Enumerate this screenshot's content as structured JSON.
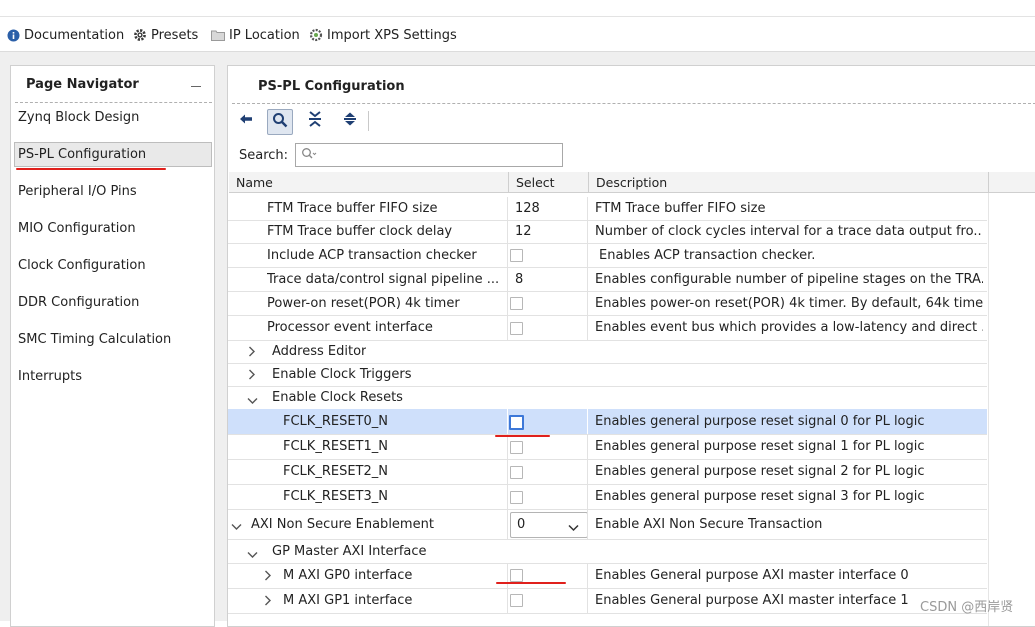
{
  "toolbar": {
    "documentation": "Documentation",
    "presets": "Presets",
    "ip_location": "IP Location",
    "import_xps": "Import XPS Settings"
  },
  "navigator": {
    "title": "Page Navigator",
    "items": [
      {
        "label": "Zynq Block Design"
      },
      {
        "label": "PS-PL Configuration"
      },
      {
        "label": "Peripheral I/O Pins"
      },
      {
        "label": "MIO Configuration"
      },
      {
        "label": "Clock Configuration"
      },
      {
        "label": "DDR Configuration"
      },
      {
        "label": "SMC Timing Calculation"
      },
      {
        "label": "Interrupts"
      }
    ],
    "selected_index": 1
  },
  "main": {
    "title": "PS-PL Configuration",
    "search_label": "Search:",
    "search_placeholder": "",
    "columns": {
      "name": "Name",
      "select": "Select",
      "description": "Description"
    },
    "rows": {
      "r0": {
        "name": "FTM Trace buffer FIFO size",
        "select": "128",
        "desc": "FTM Trace buffer FIFO size"
      },
      "r1": {
        "name": "FTM Trace buffer clock delay",
        "select": "12",
        "desc": "Number of clock cycles interval for a trace data output fro..."
      },
      "r2": {
        "name": "Include ACP transaction checker",
        "desc": "Enables ACP transaction checker."
      },
      "r3": {
        "name": "Trace data/control signal pipeline ...",
        "select": "8",
        "desc": "Enables configurable number of pipeline stages on the TRA..."
      },
      "r4": {
        "name": "Power-on reset(POR) 4k timer",
        "desc": "Enables power-on reset(POR) 4k timer. By default, 64k time..."
      },
      "r5": {
        "name": "Processor event interface",
        "desc": "Enables event bus which provides a low-latency and direct ..."
      },
      "r6": {
        "name": "Address Editor"
      },
      "r7": {
        "name": "Enable Clock Triggers"
      },
      "r8": {
        "name": "Enable Clock Resets"
      },
      "r9": {
        "name": "FCLK_RESET0_N",
        "desc": "Enables general purpose reset signal 0 for PL logic"
      },
      "r10": {
        "name": "FCLK_RESET1_N",
        "desc": "Enables general purpose reset signal 1 for PL logic"
      },
      "r11": {
        "name": "FCLK_RESET2_N",
        "desc": "Enables general purpose reset signal 2 for PL logic"
      },
      "r12": {
        "name": "FCLK_RESET3_N",
        "desc": "Enables general purpose reset signal 3 for PL logic"
      },
      "r13": {
        "name": "AXI Non Secure Enablement",
        "select": "0",
        "desc": "Enable AXI Non Secure Transaction"
      },
      "r14": {
        "name": "GP Master AXI Interface"
      },
      "r15": {
        "name": "M AXI GP0 interface",
        "desc": "Enables General purpose AXI master interface 0"
      },
      "r16": {
        "name": "M AXI GP1 interface",
        "desc": "Enables General purpose AXI master interface 1"
      }
    }
  },
  "watermark": "CSDN @西岸贤",
  "colors": {
    "selection": "#cfe0fb",
    "accent_red": "#e0201c",
    "focus_blue": "#3d78d8"
  }
}
